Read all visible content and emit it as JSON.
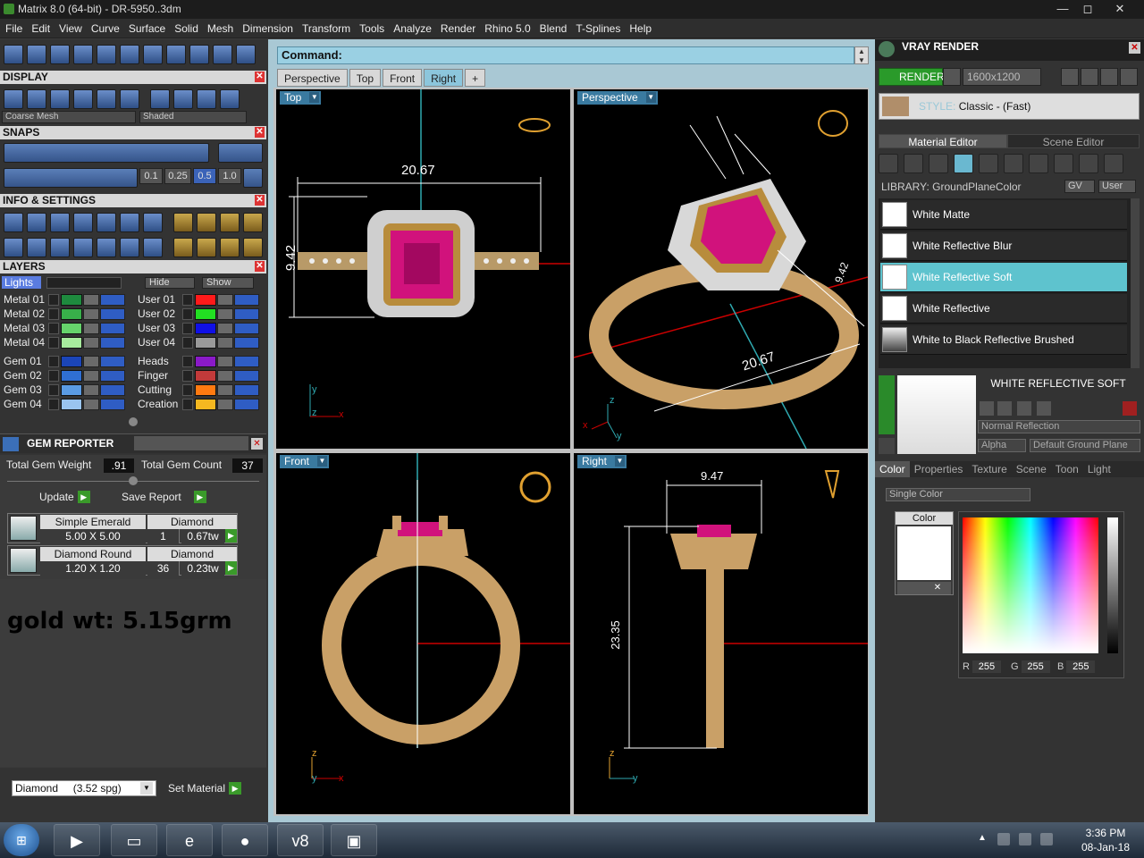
{
  "window": {
    "title": "Matrix 8.0 (64-bit) - DR-5950..3dm",
    "min": "—",
    "max": "◻",
    "close": "✕"
  },
  "menu": [
    "File",
    "Edit",
    "View",
    "Curve",
    "Surface",
    "Solid",
    "Mesh",
    "Dimension",
    "Transform",
    "Tools",
    "Analyze",
    "Render",
    "Rhino 5.0",
    "Blend",
    "T-Splines",
    "Help"
  ],
  "display": {
    "title": "DISPLAY",
    "mesh_select": "Coarse Mesh",
    "shade_select": "Shaded"
  },
  "snaps": {
    "title": "SNAPS",
    "values": [
      "0.1",
      "0.25",
      "0.5",
      "1.0"
    ]
  },
  "info": {
    "title": "INFO & SETTINGS"
  },
  "layers": {
    "title": "LAYERS",
    "lights": "Lights",
    "hide": "Hide",
    "show": "Show",
    "left": [
      {
        "name": "Metal 01",
        "color": "#1e8a3e"
      },
      {
        "name": "Metal 02",
        "color": "#38b04a"
      },
      {
        "name": "Metal 03",
        "color": "#66d36b"
      },
      {
        "name": "Metal 04",
        "color": "#a7eb9d"
      },
      {
        "name": "Gem 01",
        "color": "#1b45b8"
      },
      {
        "name": "Gem 02",
        "color": "#2f6fd3"
      },
      {
        "name": "Gem 03",
        "color": "#5a9be3"
      },
      {
        "name": "Gem 04",
        "color": "#9ac4ef"
      }
    ],
    "right": [
      {
        "name": "User 01",
        "color": "#ff1a1a"
      },
      {
        "name": "User 02",
        "color": "#22e022"
      },
      {
        "name": "User 03",
        "color": "#1010e6"
      },
      {
        "name": "User 04",
        "color": "#9a9a9a"
      },
      {
        "name": "Heads",
        "color": "#8a1ac8"
      },
      {
        "name": "Finger",
        "color": "#c23a3a"
      },
      {
        "name": "Cutting",
        "color": "#ff7a10"
      },
      {
        "name": "Creation",
        "color": "#f5b820"
      }
    ]
  },
  "gem": {
    "title": "GEM REPORTER",
    "weight_label": "Total Gem Weight",
    "weight": ".91",
    "count_label": "Total Gem Count",
    "count": "37",
    "update": "Update",
    "save": "Save Report",
    "rows": [
      {
        "name": "Simple Emerald",
        "size": "5.00 X 5.00",
        "type": "Diamond",
        "qty": "1",
        "tw": "0.67tw"
      },
      {
        "name": "Diamond Round",
        "size": "1.20 X 1.20",
        "type": "Diamond",
        "qty": "36",
        "tw": "0.23tw"
      }
    ],
    "note": "gold wt: 5.15grm",
    "material": "Diamond     (3.52 spg)",
    "set_material": "Set Material"
  },
  "command": {
    "label": "Command:"
  },
  "view_tabs": [
    "Perspective",
    "Top",
    "Front",
    "Right",
    "+"
  ],
  "viewports": {
    "top": {
      "label": "Top",
      "width": "20.67",
      "height": "9.42"
    },
    "perspective": {
      "label": "Perspective",
      "width": "20.67",
      "height": "9.42"
    },
    "front": {
      "label": "Front"
    },
    "right": {
      "label": "Right",
      "width": "9.47",
      "height": "23.35"
    }
  },
  "axes": {
    "x": "x",
    "y": "y",
    "z": "z"
  },
  "vray": {
    "title": "VRAY RENDER",
    "render": "RENDER",
    "resolution": "1600x1200",
    "style_label": "STYLE:",
    "style_value": "Classic - (Fast)",
    "tabs": [
      "Material Editor",
      "Scene Editor"
    ],
    "library": "LIBRARY: GroundPlaneColor",
    "gv": "GV",
    "user": "User",
    "materials": [
      "White Matte",
      "White Reflective Blur",
      "White Reflective Soft",
      "White Reflective",
      "White to Black Reflective Brushed"
    ],
    "selected": "WHITE REFLECTIVE SOFT",
    "reflection": "Normal Reflection",
    "alpha": "Alpha",
    "ground": "Default Ground Plane",
    "color_tabs": [
      "Color",
      "Properties",
      "Texture",
      "Scene",
      "Toon",
      "Light"
    ],
    "single_color": "Single Color",
    "color_label": "Color",
    "r_label": "R",
    "r": "255",
    "g_label": "G",
    "g": "255",
    "b_label": "B",
    "b": "255"
  },
  "taskbar": {
    "time": "3:36 PM",
    "date": "08-Jan-18"
  }
}
